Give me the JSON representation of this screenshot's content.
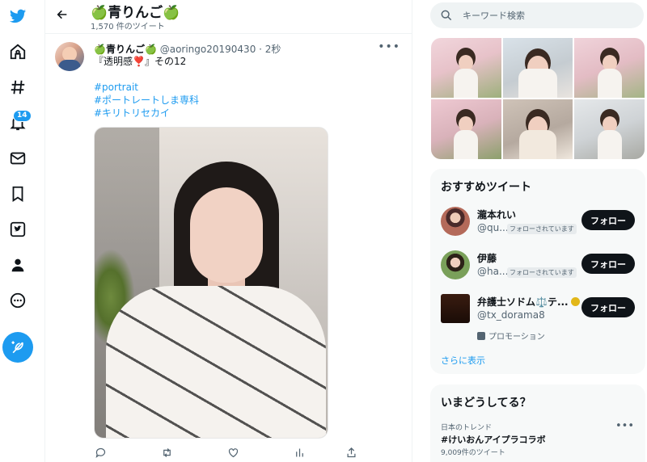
{
  "nav": {
    "items": [
      {
        "icon": "twitter-logo-icon"
      },
      {
        "icon": "home-icon"
      },
      {
        "icon": "hashtag-icon"
      },
      {
        "icon": "bell-icon",
        "badge": "14"
      },
      {
        "icon": "mail-icon"
      },
      {
        "icon": "bookmark-icon"
      },
      {
        "icon": "twitter-blue-icon"
      },
      {
        "icon": "profile-icon"
      },
      {
        "icon": "more-icon"
      }
    ],
    "compose_icon": "feather-icon"
  },
  "header": {
    "title": "🍏青りんご🍏",
    "tweet_count": "1,570 件のツイート"
  },
  "tweet": {
    "display_name": "🍏青りんご🍏",
    "handle": "@aoringo20190430",
    "separator": " · ",
    "time": "2秒",
    "text": "『透明感❣️』その12",
    "hashtags": [
      "#portrait",
      "#ポートレートしま専科",
      "#キリトリセカイ"
    ],
    "actions": [
      "reply-icon",
      "retweet-icon",
      "like-icon",
      "views-icon",
      "share-icon"
    ]
  },
  "search": {
    "placeholder": "キーワード検索"
  },
  "recommended": {
    "title": "おすすめツイート",
    "users": [
      {
        "name": "瀧本れい",
        "handle": "@qu...",
        "follows_you": "フォローされています",
        "button": "フォロー"
      },
      {
        "name": "伊藤",
        "handle": "@ha...",
        "follows_you": "フォローされています",
        "button": "フォロー"
      },
      {
        "name": "弁護士ソドム⚖️テ...",
        "handle": "@tx_dorama8",
        "promoted": "プロモーション",
        "button": "フォロー"
      }
    ],
    "show_more": "さらに表示"
  },
  "trends": {
    "title": "いまどうしてる？",
    "items": [
      {
        "label": "日本のトレンド",
        "name": "#けいおんアイプラコラボ",
        "count": "9,009件のツイート"
      }
    ]
  },
  "colors": {
    "accent": "#1d9bf0",
    "text": "#0f1419",
    "muted": "#536471",
    "card": "#f7f9f9"
  }
}
